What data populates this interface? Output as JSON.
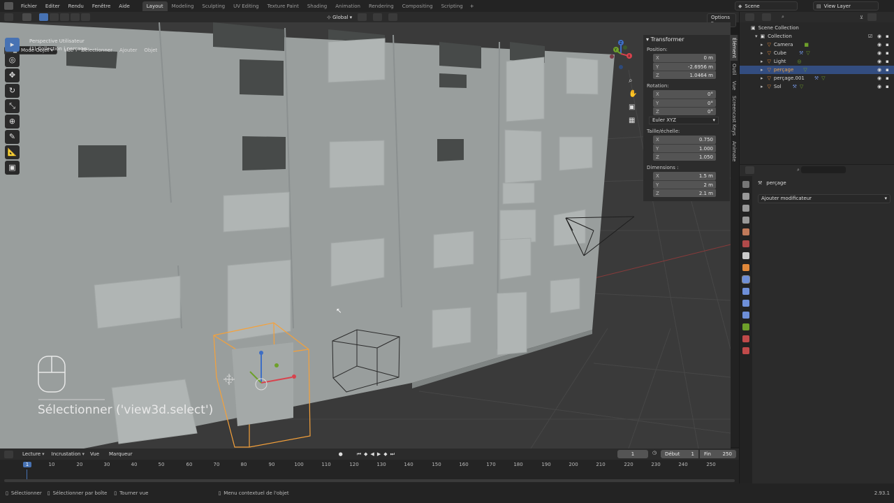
{
  "menu": [
    "Fichier",
    "Editer",
    "Rendu",
    "Fenêtre",
    "Aide"
  ],
  "workspaces": [
    "Layout",
    "Modeling",
    "Sculpting",
    "UV Editing",
    "Texture Paint",
    "Shading",
    "Animation",
    "Rendering",
    "Compositing",
    "Scripting"
  ],
  "active_workspace": "Layout",
  "scene": "Scene",
  "view_layer": "View Layer",
  "header": {
    "orientation": "Global",
    "options": "Options"
  },
  "viewport_header": {
    "mode": "Mode Objet",
    "items": [
      "Vue",
      "Sélectionner",
      "Ajouter",
      "Objet"
    ]
  },
  "viewport": {
    "view_name": "Perspective Utilisateur",
    "collection_info": "(1) Collection | perçage",
    "operator_hint": "Sélectionner ('view3d.select')",
    "gizmo_axes": [
      "Z",
      "Y",
      "X"
    ]
  },
  "npanel": {
    "title": "Transformer",
    "position_label": "Position:",
    "position": [
      {
        "axis": "X",
        "value": "0 m"
      },
      {
        "axis": "Y",
        "value": "-2.6956 m"
      },
      {
        "axis": "Z",
        "value": "1.0464 m"
      }
    ],
    "rotation_label": "Rotation:",
    "rotation": [
      {
        "axis": "X",
        "value": "0°"
      },
      {
        "axis": "Y",
        "value": "0°"
      },
      {
        "axis": "Z",
        "value": "0°"
      }
    ],
    "rotation_mode": "Euler XYZ",
    "scale_label": "Taille/échelle:",
    "scale": [
      {
        "axis": "X",
        "value": "0.750"
      },
      {
        "axis": "Y",
        "value": "1.000"
      },
      {
        "axis": "Z",
        "value": "1.050"
      }
    ],
    "dimensions_label": "Dimensions :",
    "dimensions": [
      {
        "axis": "X",
        "value": "1.5 m"
      },
      {
        "axis": "Y",
        "value": "2 m"
      },
      {
        "axis": "Z",
        "value": "2.1 m"
      }
    ]
  },
  "side_tabs": [
    "Élément",
    "Outil",
    "Vue",
    "Screencast Keys",
    "Animate"
  ],
  "outliner": {
    "root": "Scene Collection",
    "collection": "Collection",
    "items": [
      {
        "name": "Camera",
        "color": "#e0883a"
      },
      {
        "name": "Cube",
        "color": "#e0883a"
      },
      {
        "name": "Light",
        "color": "#e0883a"
      },
      {
        "name": "perçage",
        "color": "#e0883a",
        "selected": true
      },
      {
        "name": "perçage.001",
        "color": "#e0883a"
      },
      {
        "name": "Sol",
        "color": "#e0883a"
      }
    ]
  },
  "properties": {
    "object_name": "perçage",
    "add_modifier": "Ajouter modificateur"
  },
  "timeline": {
    "menus": [
      "Lecture",
      "Incrustation",
      "Vue",
      "Marqueur"
    ],
    "current_frame": "1",
    "start_label": "Début",
    "start": "1",
    "end_label": "Fin",
    "end": "250",
    "ruler": [
      "1",
      "10",
      "20",
      "30",
      "40",
      "50",
      "60",
      "70",
      "80",
      "90",
      "100",
      "110",
      "120",
      "130",
      "140",
      "150",
      "160",
      "170",
      "180",
      "190",
      "200",
      "210",
      "220",
      "230",
      "240",
      "250"
    ]
  },
  "statusbar": {
    "select": "Sélectionner",
    "box_select": "Sélectionner par boîte",
    "rotate": "Tourner vue",
    "context": "Menu contextuel de l'objet",
    "version": "2.93.1"
  },
  "colors": {
    "accent": "#4772b3",
    "selection_orange": "#f5a13a",
    "x_axis": "#d8424d",
    "y_axis": "#6ea02a",
    "z_axis": "#3e6ec4"
  }
}
